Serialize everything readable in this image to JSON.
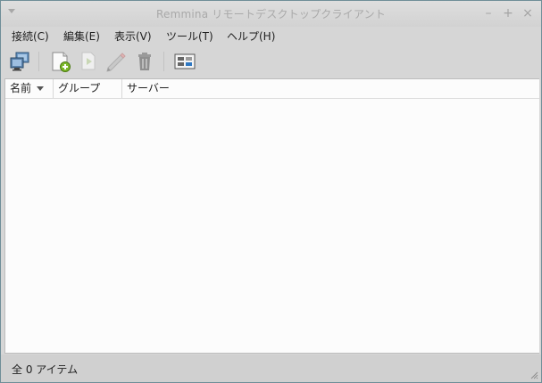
{
  "window": {
    "title": "Remmina リモートデスクトップクライアント",
    "controls": {
      "minimize": "–",
      "maximize": "+",
      "close": "×"
    }
  },
  "menubar": {
    "items": [
      {
        "label": "接続(C)"
      },
      {
        "label": "編集(E)"
      },
      {
        "label": "表示(V)"
      },
      {
        "label": "ツール(T)"
      },
      {
        "label": "ヘルプ(H)"
      }
    ]
  },
  "toolbar": {
    "buttons": [
      {
        "icon": "connect-icon"
      },
      {
        "icon": "new-profile-icon"
      },
      {
        "icon": "copy-profile-icon",
        "enabled": false
      },
      {
        "icon": "edit-profile-icon",
        "enabled": false
      },
      {
        "icon": "delete-profile-icon",
        "enabled": false
      },
      {
        "icon": "view-toggle-icon"
      }
    ]
  },
  "list": {
    "columns": [
      {
        "label": "名前",
        "sorted": true
      },
      {
        "label": "グループ"
      },
      {
        "label": "サーバー"
      }
    ],
    "rows": []
  },
  "statusbar": {
    "text": "全 0 アイテム"
  }
}
